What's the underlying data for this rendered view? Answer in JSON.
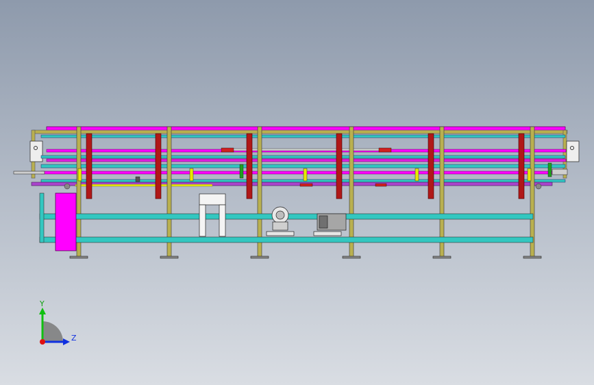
{
  "viewport": {
    "background_top": "#8e9aac",
    "background_bottom": "#d9dde3",
    "model_description_icon": "conveyor-machine-assembly"
  },
  "triad": {
    "y_label": "Y",
    "z_label": "Z",
    "colors": {
      "x": "#e01010",
      "y": "#10c010",
      "z": "#1030e0"
    }
  },
  "colors": {
    "magenta": "#ff00ff",
    "teal": "#33c7c0",
    "olive": "#b9b050",
    "red": "#b01818",
    "yellow": "#e8e800",
    "purple": "#9933aa",
    "gray": "#9aa0a6"
  }
}
